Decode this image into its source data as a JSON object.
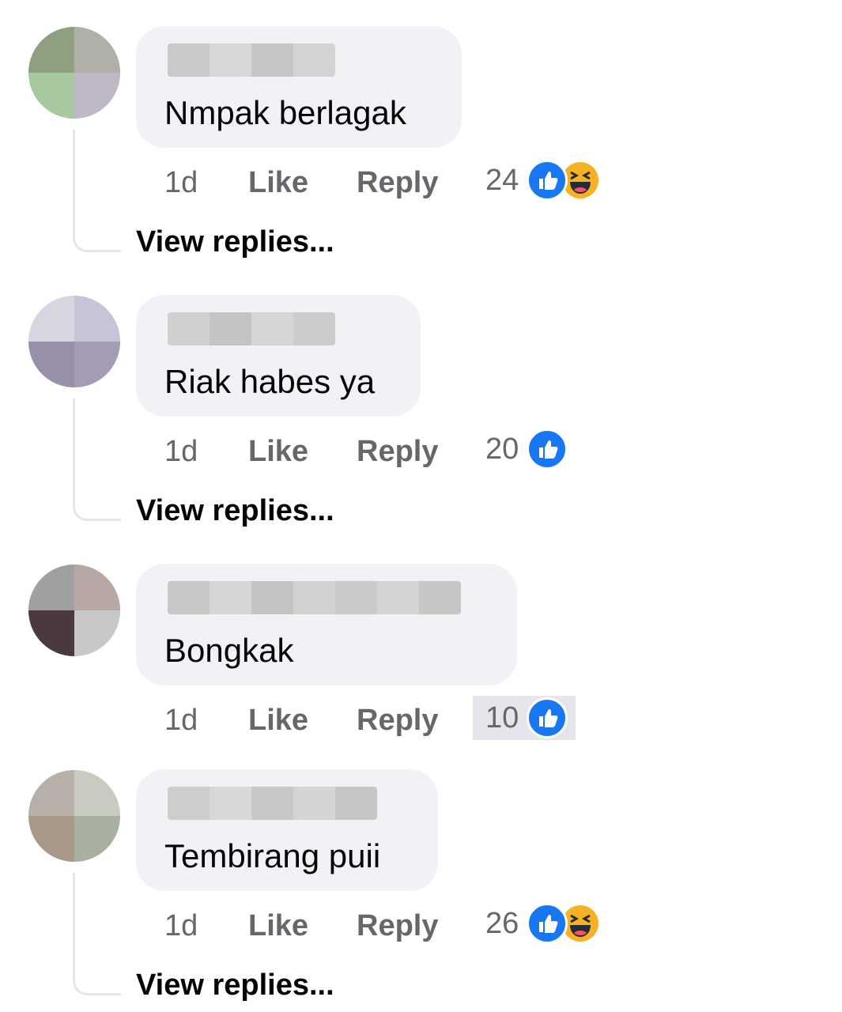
{
  "comments": [
    {
      "text": "Nmpak berlagak",
      "time": "1d",
      "like_label": "Like",
      "reply_label": "Reply",
      "reaction_count": "24",
      "reactions": [
        "like-icon",
        "haha-icon"
      ],
      "view_replies": "View replies..."
    },
    {
      "text": "Riak habes ya",
      "time": "1d",
      "like_label": "Like",
      "reply_label": "Reply",
      "reaction_count": "20",
      "reactions": [
        "like-icon"
      ],
      "view_replies": "View replies..."
    },
    {
      "text": "Bongkak",
      "time": "1d",
      "like_label": "Like",
      "reply_label": "Reply",
      "reaction_count": "10",
      "reactions": [
        "like-icon"
      ],
      "view_replies": ""
    },
    {
      "text": "Tembirang puii",
      "time": "1d",
      "like_label": "Like",
      "reply_label": "Reply",
      "reaction_count": "26",
      "reactions": [
        "like-icon",
        "haha-icon"
      ],
      "view_replies": "View replies..."
    }
  ],
  "colors": {
    "bubble": "#f0f2f5",
    "like_blue": "#1877f2",
    "haha_yellow": "#f7b125",
    "action_gray": "#65676b",
    "text_dark": "#050505"
  }
}
